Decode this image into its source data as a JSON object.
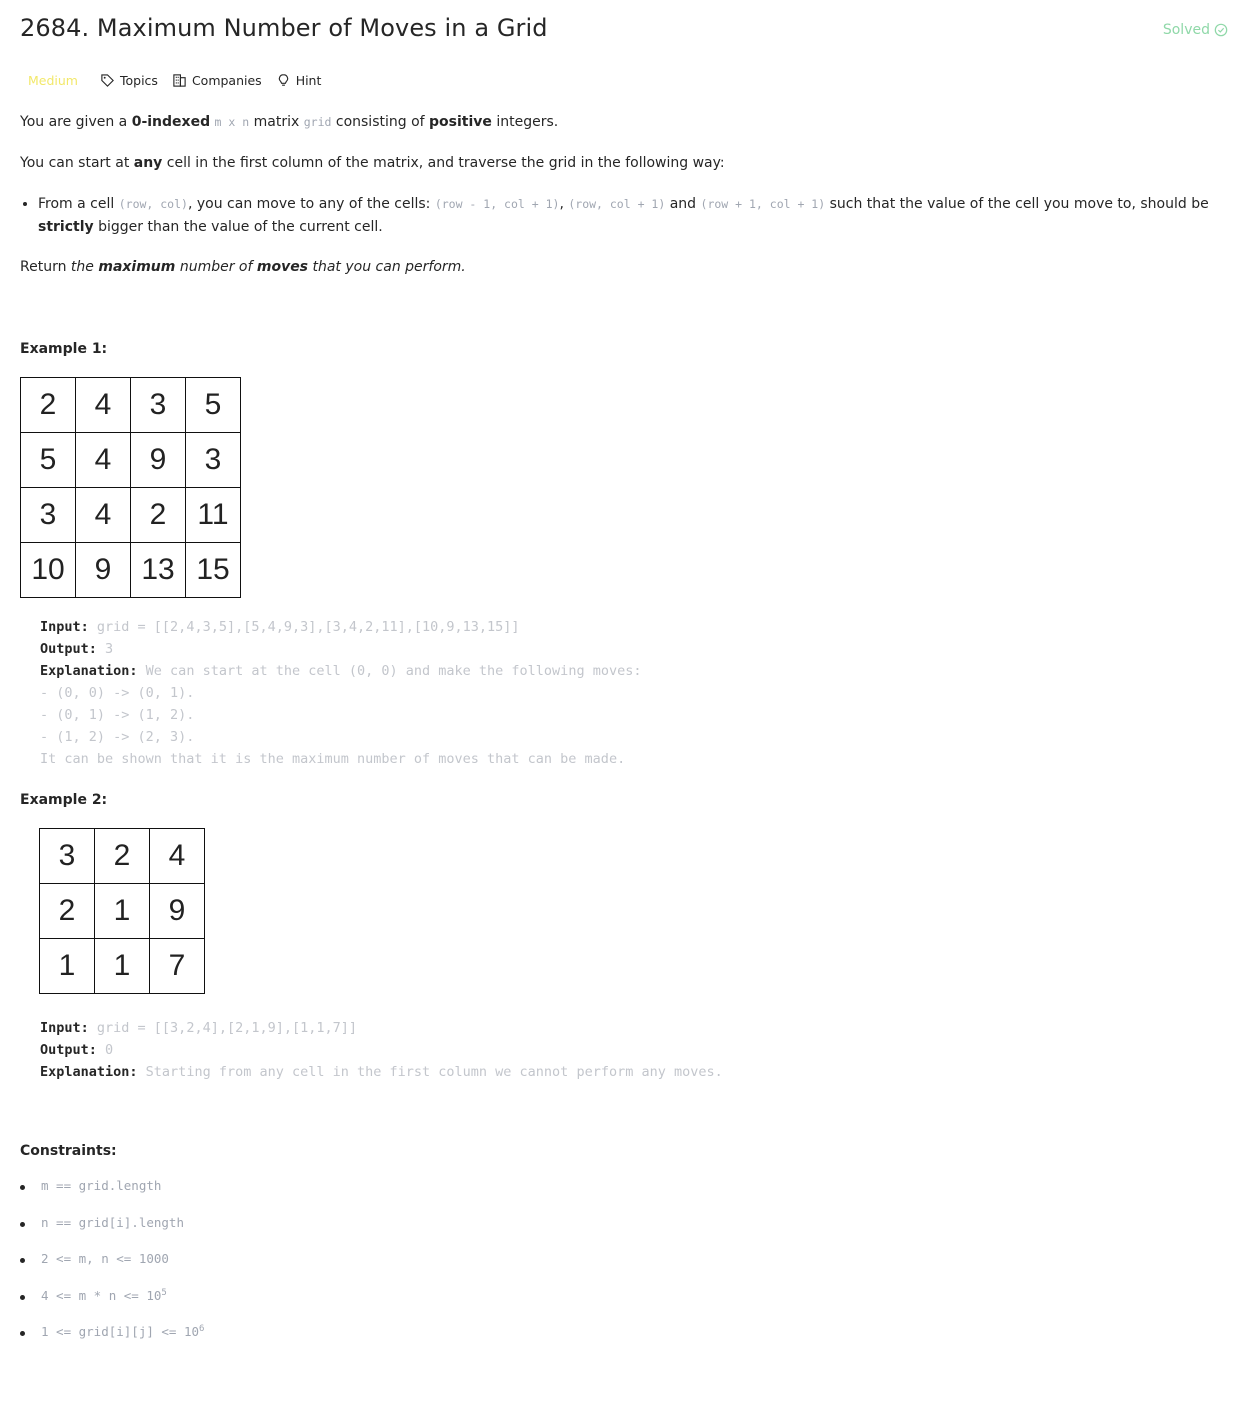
{
  "header": {
    "title": "2684. Maximum Number of Moves in a Grid",
    "status": "Solved"
  },
  "tags": {
    "difficulty": "Medium",
    "topics": "Topics",
    "companies": "Companies",
    "hint": "Hint"
  },
  "description": {
    "p1_a": "You are given a ",
    "p1_b": "0-indexed",
    "p1_c": " ",
    "p1_code1": "m x n",
    "p1_d": " matrix ",
    "p1_code2": "grid",
    "p1_e": " consisting of ",
    "p1_f": "positive",
    "p1_g": " integers.",
    "p2_a": "You can start at ",
    "p2_b": "any",
    "p2_c": " cell in the first column of the matrix, and traverse the grid in the following way:",
    "b1_a": "From a cell ",
    "b1_code1": "(row, col)",
    "b1_b": ", you can move to any of the cells: ",
    "b1_code2": "(row - 1, col + 1)",
    "b1_c": ", ",
    "b1_code3": "(row, col + 1)",
    "b1_d": " and ",
    "b1_code4": "(row + 1, col + 1)",
    "b1_e": " such that the value of the cell you move to, should be ",
    "b1_f": "strictly",
    "b1_g": " bigger than the value of the current cell.",
    "p3_a": "Return ",
    "p3_b": "the ",
    "p3_c": "maximum",
    "p3_d": " number of ",
    "p3_e": "moves",
    "p3_f": " that you can perform."
  },
  "example1": {
    "label": "Example 1:",
    "grid": [
      [
        "2",
        "4",
        "3",
        "5"
      ],
      [
        "5",
        "4",
        "9",
        "3"
      ],
      [
        "3",
        "4",
        "2",
        "11"
      ],
      [
        "10",
        "9",
        "13",
        "15"
      ]
    ],
    "input_label": "Input:",
    "input_value": " grid = [[2,4,3,5],[5,4,9,3],[3,4,2,11],[10,9,13,15]]",
    "output_label": "Output:",
    "output_value": " 3",
    "expl_label": "Explanation:",
    "expl_value": " We can start at the cell (0, 0) and make the following moves:",
    "line1": "- (0, 0) -> (0, 1).",
    "line2": "- (0, 1) -> (1, 2).",
    "line3": "- (1, 2) -> (2, 3).",
    "line4": "It can be shown that it is the maximum number of moves that can be made."
  },
  "example2": {
    "label": "Example 2:",
    "grid": [
      [
        "3",
        "2",
        "4"
      ],
      [
        "2",
        "1",
        "9"
      ],
      [
        "1",
        "1",
        "7"
      ]
    ],
    "input_label": "Input:",
    "input_value": " grid = [[3,2,4],[2,1,9],[1,1,7]]",
    "output_label": "Output:",
    "output_value": " 0",
    "expl_label": "Explanation:",
    "expl_value": " Starting from any cell in the first column we cannot perform any moves."
  },
  "constraints": {
    "label": "Constraints:",
    "c1": "m == grid.length",
    "c2": "n == grid[i].length",
    "c3": "2 <= m, n <= 1000",
    "c4": "4 <= m * n <= 10",
    "c4_sup": "5",
    "c5": "1 <= grid[i][j] <= 10",
    "c5_sup": "6"
  },
  "colors": {
    "difficulty": "#f2e86a",
    "solved": "#8fd8a8",
    "code": "#a0a6b1"
  }
}
